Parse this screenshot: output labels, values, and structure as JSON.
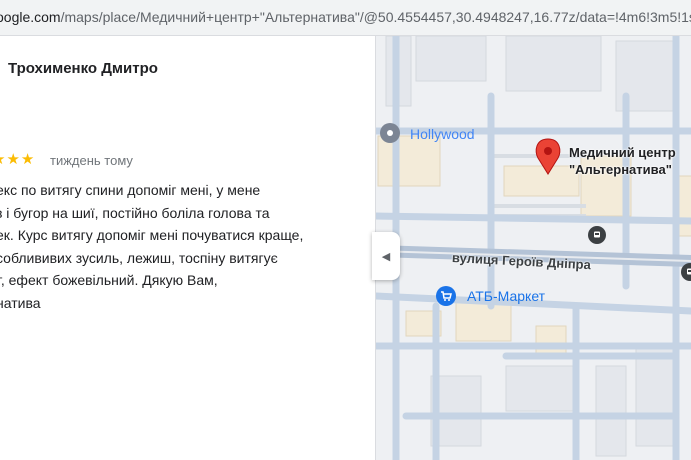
{
  "browser": {
    "url_host": "oogle.com",
    "url_path": "/maps/place/Медичний+центр+\"Альтернатива\"/@50.4554457,30.4948247,16.77z/data=!4m6!3m5!1s0x"
  },
  "review": {
    "reviewer_name": "Трохименко Дмитро",
    "stars": "★★★",
    "time_ago": "тиждень тому",
    "lines": [
      "екс по витягу спини допоміг мені, у мене",
      "з і бугор на шиї, постійно боліла голова та",
      "ек. Курс витягу допоміг мені почуватися краще,",
      "соблививих зусиль, лежиш, тоспіну витягує",
      "т, ефект божевільний. Дякую Вам,",
      "натива"
    ]
  },
  "map": {
    "hollywood_label": "Hollywood",
    "center_label_line1": "Медичний центр",
    "center_label_line2": "\"Альтернатива\"",
    "street_label": "вулиця Героїв Дніпра",
    "atb_label": "АТБ-Маркет",
    "collapse_glyph": "◀",
    "colors": {
      "pin": "#ea4335",
      "poi_blue": "#1a73e8",
      "road": "#c5d3e4",
      "building": "#f3ebd9"
    }
  }
}
